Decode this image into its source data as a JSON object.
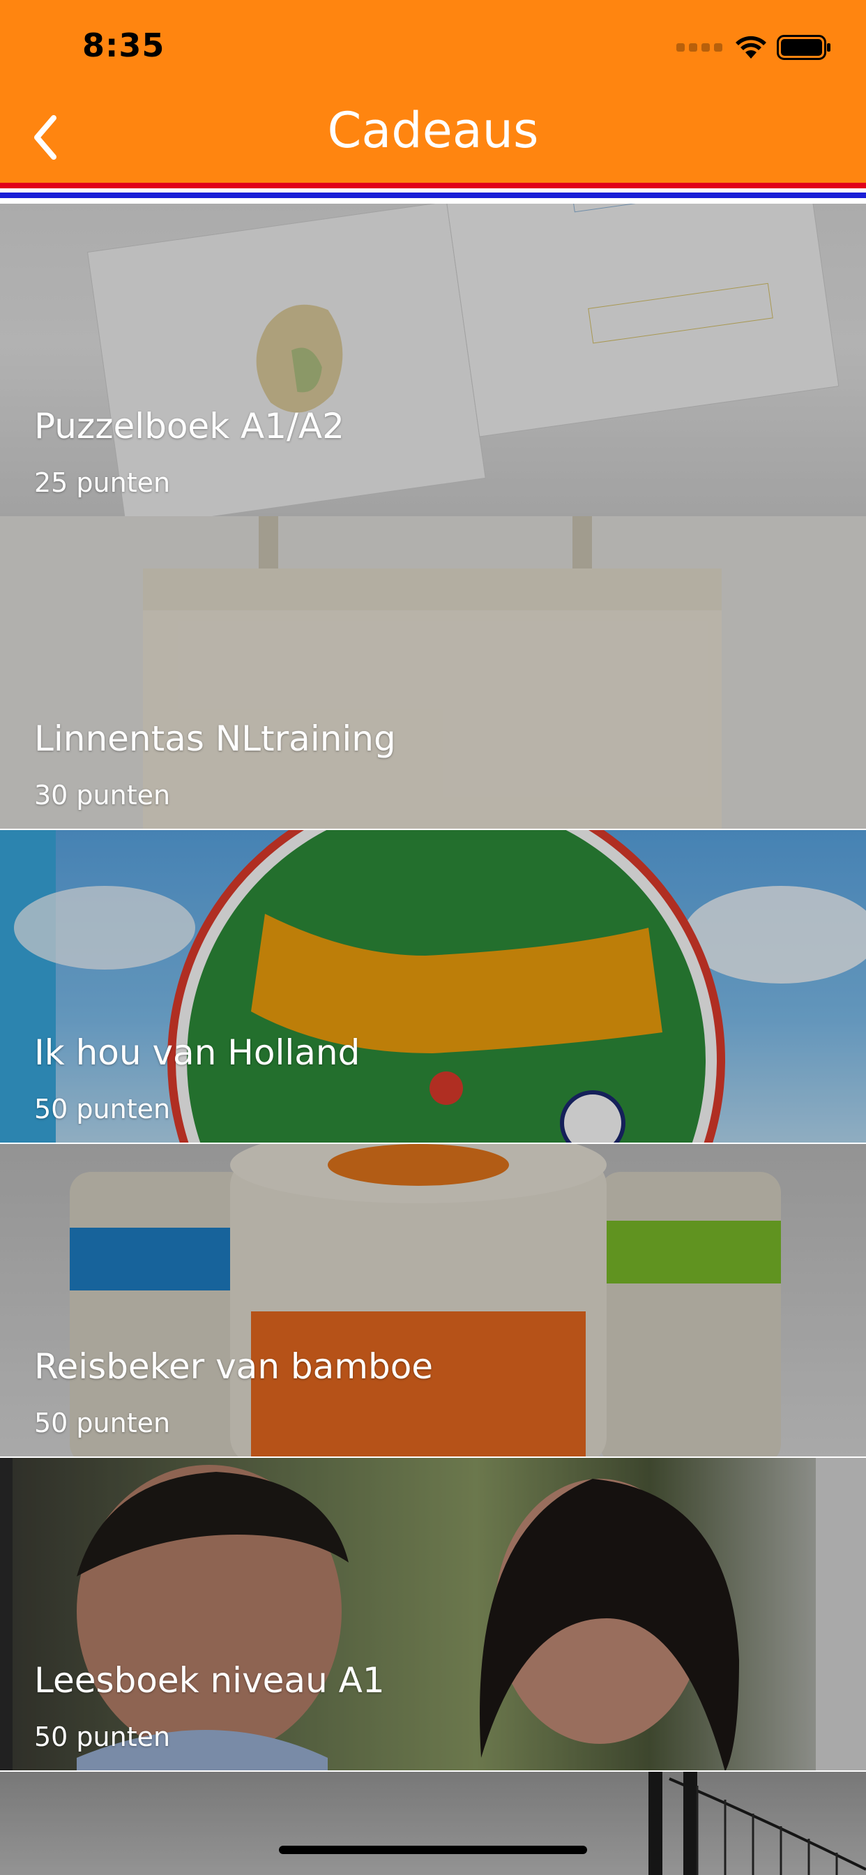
{
  "status_bar": {
    "time": "8:35"
  },
  "nav": {
    "title": "Cadeaus",
    "back_icon": "chevron-left-icon"
  },
  "colors": {
    "header": "#ff8510",
    "flag_red": "#e1001a",
    "flag_blue": "#1b1fd6",
    "text_on_image": "#ffffff"
  },
  "gifts": [
    {
      "name": "Puzzelboek A1/A2",
      "points": "25 punten",
      "image": "puzzle-book-photo"
    },
    {
      "name": "Linnentas NLtraining",
      "points": "30 punten",
      "image": "canvas-tote-bag-photo"
    },
    {
      "name": "Ik hou van Holland",
      "points": "50 punten",
      "image": "game-box-photo"
    },
    {
      "name": "Reisbeker van bamboe",
      "points": "50 punten",
      "image": "bamboo-cups-photo"
    },
    {
      "name": "Leesboek niveau A1",
      "points": "50 punten",
      "image": "couple-photo"
    }
  ],
  "ik_hou_banner": "Ik hou van Holland"
}
